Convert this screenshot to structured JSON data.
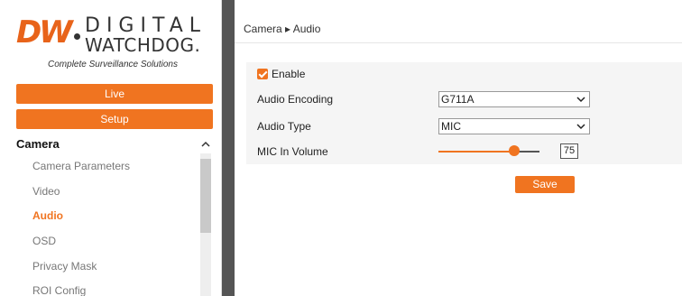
{
  "brand": {
    "mark": "DW",
    "line1": "DIGITAL",
    "line2": "WATCHDOG.",
    "tagline": "Complete Surveillance Solutions",
    "accent_color": "#f07420"
  },
  "nav": {
    "live_label": "Live",
    "setup_label": "Setup"
  },
  "sidebar": {
    "section_title": "Camera",
    "items": [
      {
        "label": "Camera Parameters",
        "active": false
      },
      {
        "label": "Video",
        "active": false
      },
      {
        "label": "Audio",
        "active": true
      },
      {
        "label": "OSD",
        "active": false
      },
      {
        "label": "Privacy Mask",
        "active": false
      },
      {
        "label": "ROI Config",
        "active": false
      }
    ]
  },
  "breadcrumb": {
    "text": "Camera ▸ Audio"
  },
  "form": {
    "enable_label": "Enable",
    "enable_checked": true,
    "encoding_label": "Audio Encoding",
    "encoding_value": "G711A",
    "type_label": "Audio Type",
    "type_value": "MIC",
    "volume_label": "MIC In Volume",
    "volume_value": "75",
    "volume_fraction": 0.75,
    "save_label": "Save"
  }
}
